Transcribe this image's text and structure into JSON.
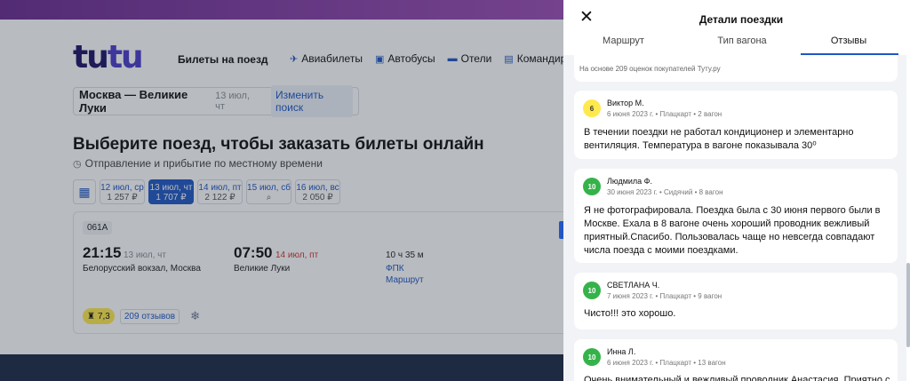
{
  "header": {
    "logo_a": "tu",
    "logo_b": "tu",
    "logo_sub": "Билеты на поезд",
    "nav": [
      {
        "label": "Авиабилеты",
        "icon": "plane-icon"
      },
      {
        "label": "Автобусы",
        "icon": "bus-icon"
      },
      {
        "label": "Отели",
        "icon": "bed-icon"
      },
      {
        "label": "Командировки",
        "icon": "briefcase-icon"
      }
    ]
  },
  "search": {
    "route": "Москва — Великие Луки",
    "date": "13 июл, чт",
    "change": "Изменить поиск"
  },
  "main": {
    "title": "Выберите поезд, чтобы заказать билеты онлайн",
    "subtitle": "Отправление и прибытие по местному времени",
    "dates": [
      {
        "day": "12 июл, ср",
        "price": "1 257 ₽"
      },
      {
        "day": "13 июл, чт",
        "price": "1 707 ₽"
      },
      {
        "day": "14 июл, пт",
        "price": "2 122 ₽"
      },
      {
        "day": "15 июл, сб",
        "price": "⌕"
      },
      {
        "day": "16 июл, вс",
        "price": "2 050 ₽"
      }
    ]
  },
  "train": {
    "code": "061А",
    "dep_time": "21:15",
    "dep_date": "13 июл, чт",
    "dep_station": "Белорусский вокзал, Москва",
    "arr_time": "07:50",
    "arr_date": "14 июл, пт",
    "arr_station": "Великие Луки",
    "duration": "10 ч 35 м",
    "carrier": "ФПК",
    "route_link": "Маршрут",
    "rating": "7,3",
    "reviews": "209 отзывов"
  },
  "drawer": {
    "title": "Детали поездки",
    "tabs": [
      "Маршрут",
      "Тип вагона",
      "Отзывы"
    ],
    "based_on": "На основе 209 оценок покупателей Туту.ру",
    "reviews": [
      {
        "score": "6",
        "name": "Виктор М.",
        "meta": "6 июня 2023 г. • Плацкарт • 2 вагон",
        "text": "В течении поездки не работал кондиционер и элементарно вентиляция. Температура в вагоне показывала 30⁰"
      },
      {
        "score": "10",
        "name": "Людмила Ф.",
        "meta": "30 июня 2023 г. • Сидячий • 8 вагон",
        "text": "Я не фотографировала. Поездка была с 30 июня первого были в Москве. Ехала в 8 вагоне очень хороший проводник вежливый приятный.Спасибо. Пользовалась чаще но невсегда совпадают числа поезда с моими поездками."
      },
      {
        "score": "10",
        "name": "СВЕТЛАНА Ч.",
        "meta": "7 июня 2023 г. • Плацкарт • 9 вагон",
        "text": "Чисто!!! это хорошо."
      },
      {
        "score": "10",
        "name": "Инна Л.",
        "meta": "6 июня 2023 г. • Плацкарт • 13 вагон",
        "text": "Очень внимательный и вежливый проводник Анастасия. Приятно с"
      }
    ]
  }
}
